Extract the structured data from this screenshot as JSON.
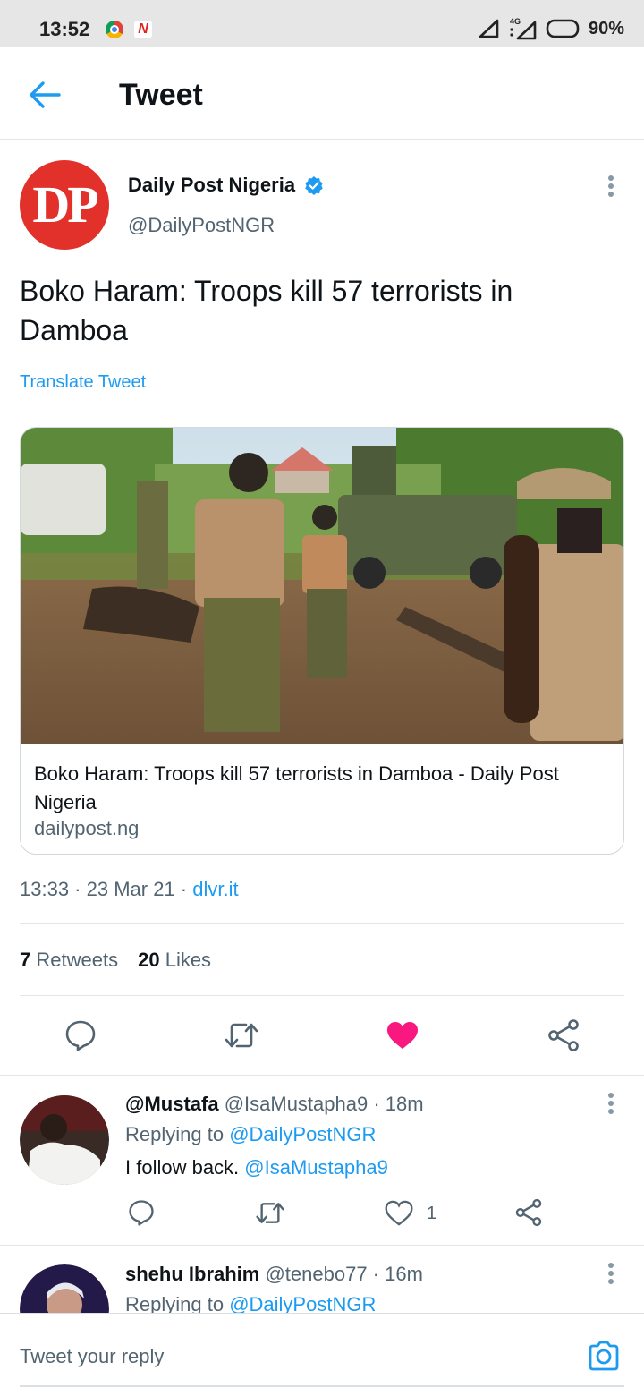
{
  "status_bar": {
    "time": "13:52",
    "network": "4G",
    "battery": "90%",
    "icons": [
      "chrome-icon",
      "news-icon",
      "signal-icon",
      "4g-signal-icon",
      "battery-icon"
    ]
  },
  "app_bar": {
    "title": "Tweet",
    "back_icon": "arrow-left-icon"
  },
  "tweet": {
    "author": {
      "name": "Daily Post Nigeria",
      "handle": "@DailyPostNGR",
      "avatar_text": "DP",
      "verified": true
    },
    "text": "Boko Haram: Troops kill 57 terrorists in Damboa",
    "translate_label": "Translate Tweet",
    "card": {
      "title": "Boko Haram: Troops kill 57 terrorists in Damboa - Daily Post Nigeria",
      "domain": "dailypost.ng"
    },
    "timestamp": "13:33 · 23 Mar 21 · ",
    "source": "dlvr.it",
    "stats": {
      "retweets_count": "7",
      "retweets_label": "Retweets",
      "likes_count": "20",
      "likes_label": "Likes"
    },
    "actions": [
      "reply-icon",
      "retweet-icon",
      "like-icon",
      "share-icon"
    ],
    "liked": true
  },
  "replies": [
    {
      "name": "@Mustafa",
      "handle_time": " @IsaMustapha9 · 18m",
      "replying_label": "Replying to ",
      "replying_to": "@DailyPostNGR",
      "text": "I follow back. ",
      "mention": "@IsaMustapha9",
      "like_count": "1"
    },
    {
      "name": "shehu Ibrahim",
      "handle_time": " @tenebo77 · 16m",
      "replying_label": "Replying to ",
      "replying_to": "@DailyPostNGR"
    }
  ],
  "compose": {
    "placeholder": "Tweet your reply",
    "camera_icon": "camera-icon"
  },
  "colors": {
    "accent": "#1d9bf0",
    "like": "#f91880",
    "brand_dp": "#e2302a",
    "secondary_text": "#536471"
  }
}
